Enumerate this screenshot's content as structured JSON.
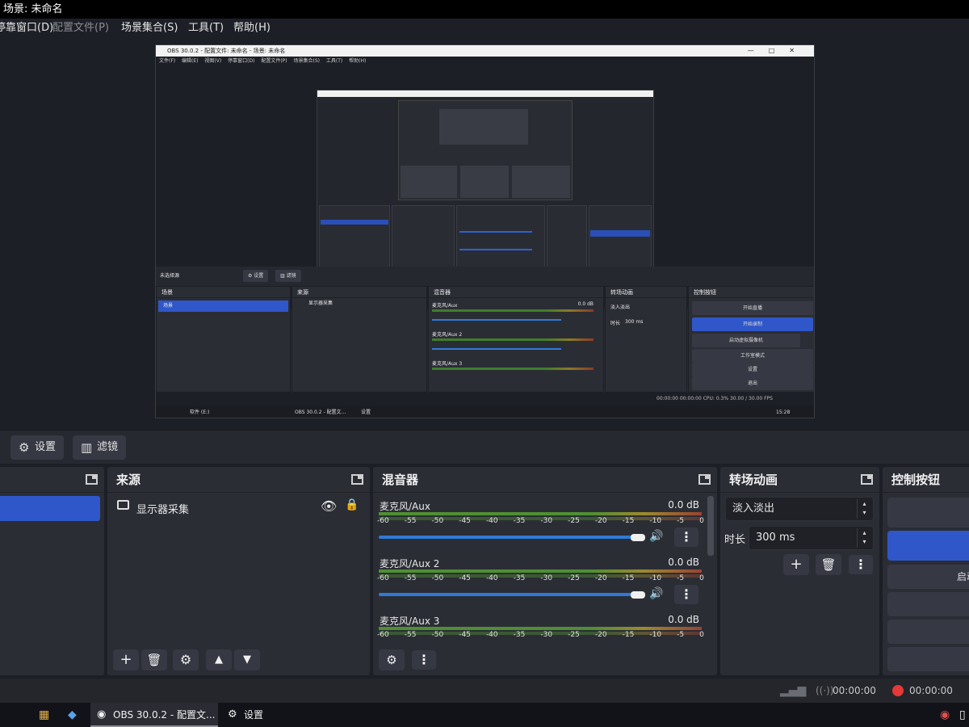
{
  "window": {
    "title": "场景: 未命名"
  },
  "menu": {
    "items": [
      "停靠窗口(D)",
      "配置文件(P)",
      "场景集合(S)",
      "工具(T)",
      "帮助(H)"
    ]
  },
  "nested_preview": {
    "title": "OBS 30.0.2 - 配置文件: 未命名 - 场景: 未命名",
    "menu_text": "文件(F) 编辑(E) 视图(V) 停靠窗口(D) 配置文件(P) 场景集合(S) 工具(T) 帮助(H)",
    "no_source": "未选择源",
    "settings_chip": "⚙ 设置",
    "filters_chip": "▥ 滤镜",
    "scenes_header": "场景",
    "scene_item": "场景",
    "sources_header": "来源",
    "source_item": "显示器采集",
    "mixer_header": "混音器",
    "mixer_ch1": "麦克风/Aux",
    "mixer_ch2": "麦克风/Aux 2",
    "mixer_ch3": "麦克风/Aux 3",
    "mixer_db": "0.0 dB",
    "transitions_header": "转场动画",
    "transition_value": "淡入淡出",
    "duration_label": "时长",
    "duration_value": "300 ms",
    "controls_header": "控制按钮",
    "ctrl_buttons": [
      "开始直播",
      "开始录制",
      "启动虚拟摄像机",
      "工作室模式",
      "设置",
      "退出"
    ],
    "status_text": "00:00:00     00:00:00     CPU: 0.3%     30.00 / 30.00 FPS",
    "taskbar_items": [
      "软件 (E:)",
      "OBS 30.0.2 - 配置文...",
      "设置"
    ],
    "clock": "15:28"
  },
  "toolbar": {
    "settings_label": "设置",
    "filters_label": "滤镜"
  },
  "sources": {
    "header": "来源",
    "items": [
      {
        "label": "显示器采集"
      }
    ]
  },
  "mixer": {
    "header": "混音器",
    "ticks": [
      "-60",
      "-55",
      "-50",
      "-45",
      "-40",
      "-35",
      "-30",
      "-25",
      "-20",
      "-15",
      "-10",
      "-5",
      "0"
    ],
    "channels": [
      {
        "name": "麦克风/Aux",
        "db": "0.0 dB"
      },
      {
        "name": "麦克风/Aux 2",
        "db": "0.0 dB"
      },
      {
        "name": "麦克风/Aux 3",
        "db": "0.0 dB"
      }
    ]
  },
  "transitions": {
    "header": "转场动画",
    "selected": "淡入淡出",
    "duration_label": "时长",
    "duration_value": "300 ms"
  },
  "controls": {
    "header": "控制按钮",
    "partial_label": "启动"
  },
  "status": {
    "stream_time": "00:00:00",
    "rec_time": "00:00:00"
  },
  "taskbar": {
    "obs_label": "OBS 30.0.2 - 配置文...",
    "settings_label": "设置"
  },
  "colors": {
    "accent": "#2f57c9",
    "rec": "#e53935",
    "slider": "#2f7ad8"
  }
}
